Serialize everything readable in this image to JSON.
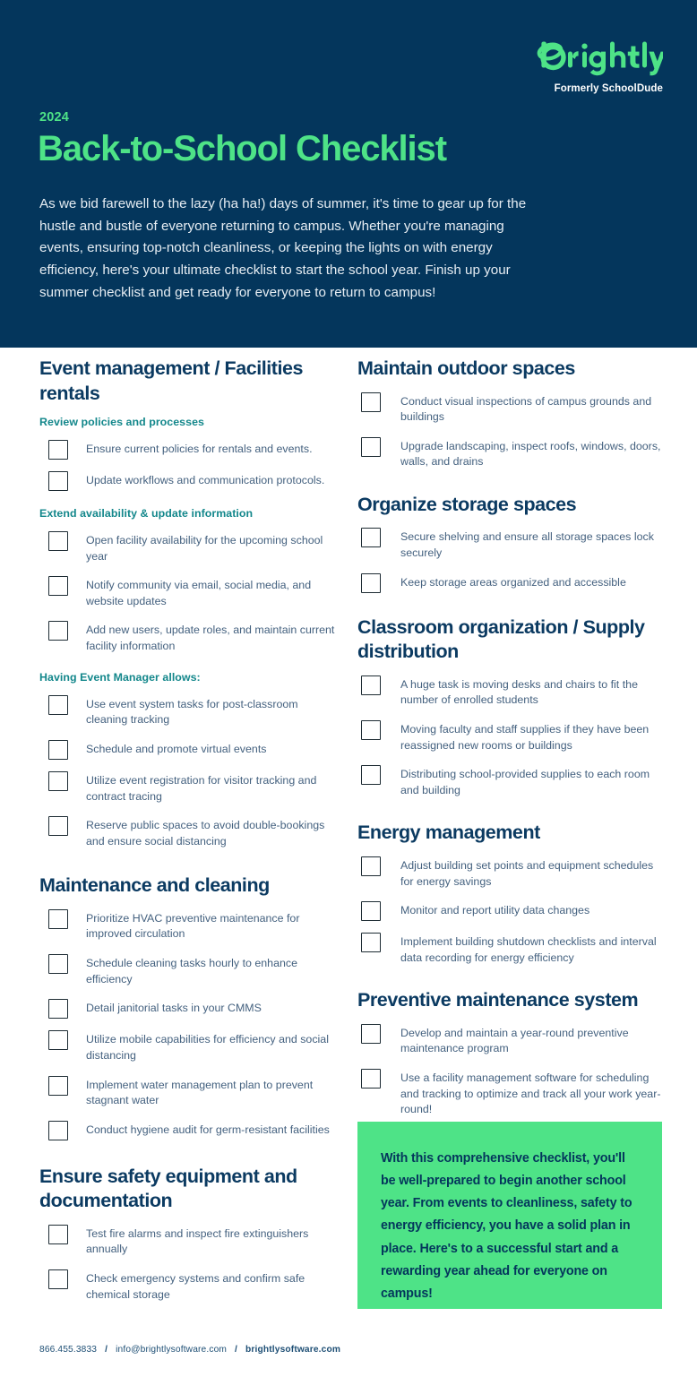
{
  "brand": {
    "logo_name": "Brightly",
    "logo_tagline": "Formerly SchoolDude",
    "green": "#4EE387",
    "navy": "#04365C",
    "teal": "#13878B",
    "body_blue": "#44617F"
  },
  "hero": {
    "year": "2024",
    "title": "Back-to-School Checklist",
    "paragraph": "As we bid farewell to the lazy (ha ha!) days of summer, it's time to gear up for the hustle and bustle of everyone returning to campus. Whether you're managing events, ensuring top-notch cleanliness, or keeping the lights on with energy efficiency, here's your ultimate checklist to start the school year. Finish up your summer checklist and get ready for everyone to return to campus!"
  },
  "left_column": [
    {
      "type": "section",
      "heading": "Event management / Facilities rentals",
      "groups": [
        {
          "subheading": "Review policies and processes",
          "items": [
            "Ensure current policies for rentals and events.",
            "Update workflows and communication protocols."
          ]
        },
        {
          "subheading": "Extend availability & update information",
          "items": [
            "Open facility availability for the upcoming school  year",
            "Notify community via email, social media, and website updates",
            "Add new users, update roles, and maintain current facility information"
          ]
        },
        {
          "subheading": "Having Event Manager allows:",
          "items": [
            "Use event system tasks for post-classroom cleaning tracking",
            "Schedule and promote virtual events",
            "Utilize event registration for visitor tracking and contract tracing",
            "Reserve public spaces to avoid double-bookings and ensure social distancing"
          ]
        }
      ]
    },
    {
      "type": "section",
      "heading": "Maintenance and cleaning",
      "groups": [
        {
          "subheading": "",
          "items": [
            "Prioritize HVAC preventive maintenance for improved circulation",
            "Schedule cleaning tasks hourly to enhance efficiency",
            "Detail janitorial tasks in your CMMS",
            "Utilize mobile capabilities for efficiency and social distancing",
            "Implement water management plan to prevent stagnant water",
            "Conduct hygiene audit for germ-resistant facilities"
          ]
        }
      ]
    },
    {
      "type": "section",
      "heading": "Ensure safety equipment and documentation",
      "groups": [
        {
          "subheading": "",
          "items": [
            "Test fire alarms and inspect fire extinguishers annually",
            "Check emergency systems and confirm safe chemical storage"
          ]
        }
      ]
    }
  ],
  "right_column": [
    {
      "type": "section",
      "heading": "Maintain outdoor spaces",
      "groups": [
        {
          "subheading": "",
          "items": [
            "Conduct visual inspections of campus grounds and buildings",
            "Upgrade landscaping, inspect roofs, windows, doors, walls, and drains"
          ]
        }
      ]
    },
    {
      "type": "section",
      "heading": "Organize storage spaces",
      "groups": [
        {
          "subheading": "",
          "items": [
            "Secure shelving and ensure all storage spaces lock securely",
            "Keep storage areas organized and accessible"
          ]
        }
      ]
    },
    {
      "type": "section",
      "heading": "Classroom organization / Supply distribution",
      "groups": [
        {
          "subheading": "",
          "items": [
            "A huge task is moving desks and chairs to fit the number of enrolled students",
            "Moving faculty and staff supplies if they have been reassigned new rooms or buildings",
            "Distributing school-provided supplies to each room and building"
          ]
        }
      ]
    },
    {
      "type": "section",
      "heading": "Energy management",
      "groups": [
        {
          "subheading": "",
          "items": [
            "Adjust building set points and equipment schedules for energy savings",
            "Monitor and report utility data changes",
            "Implement building shutdown checklists and interval data recording for energy efficiency"
          ]
        }
      ]
    },
    {
      "type": "section",
      "heading": "Preventive maintenance system",
      "groups": [
        {
          "subheading": "",
          "items": [
            "Develop and maintain a year-round preventive maintenance program",
            "Use a facility management software for scheduling and tracking to optimize and track all your work year-round!"
          ]
        }
      ]
    }
  ],
  "callout": {
    "text": "With this comprehensive checklist, you'll be well-prepared to begin another school year. From events to cleanliness, safety to energy efficiency, you have a solid plan in place. Here's to a successful start and a rewarding year ahead for everyone on campus!"
  },
  "footer": {
    "phone": "866.455.3833",
    "separator_1": "/",
    "email": "info@brightlysoftware.com",
    "separator_2": "/",
    "website": "brightlysoftware.com"
  }
}
